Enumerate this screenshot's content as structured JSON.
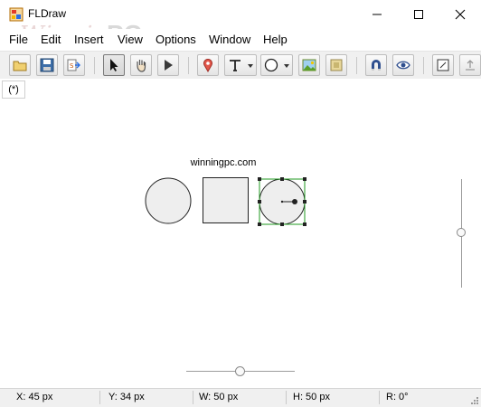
{
  "window": {
    "title": "FLDraw"
  },
  "watermark": {
    "script": "Winning",
    "bold": "PC"
  },
  "menu": [
    "File",
    "Edit",
    "Insert",
    "View",
    "Options",
    "Window",
    "Help"
  ],
  "document": {
    "tab_label": "(*)"
  },
  "canvas": {
    "caption": "winningpc.com"
  },
  "selection_color": "#1f9a1f",
  "shape_fill": "#eeeeee",
  "status": {
    "x": "X:  45 px",
    "y": "Y:  34 px",
    "w": "W:  50 px",
    "h": "H:  50 px",
    "r": "R:  0°"
  },
  "toolbar_icons": [
    "open-icon",
    "save-icon",
    "export-icon",
    "select-arrow-icon",
    "hand-icon",
    "play-icon",
    "pin-icon",
    "text-icon",
    "circle-shape-icon",
    "image-icon",
    "frame-icon",
    "magnet-icon",
    "eye-icon",
    "resize-icon",
    "upload-icon"
  ]
}
